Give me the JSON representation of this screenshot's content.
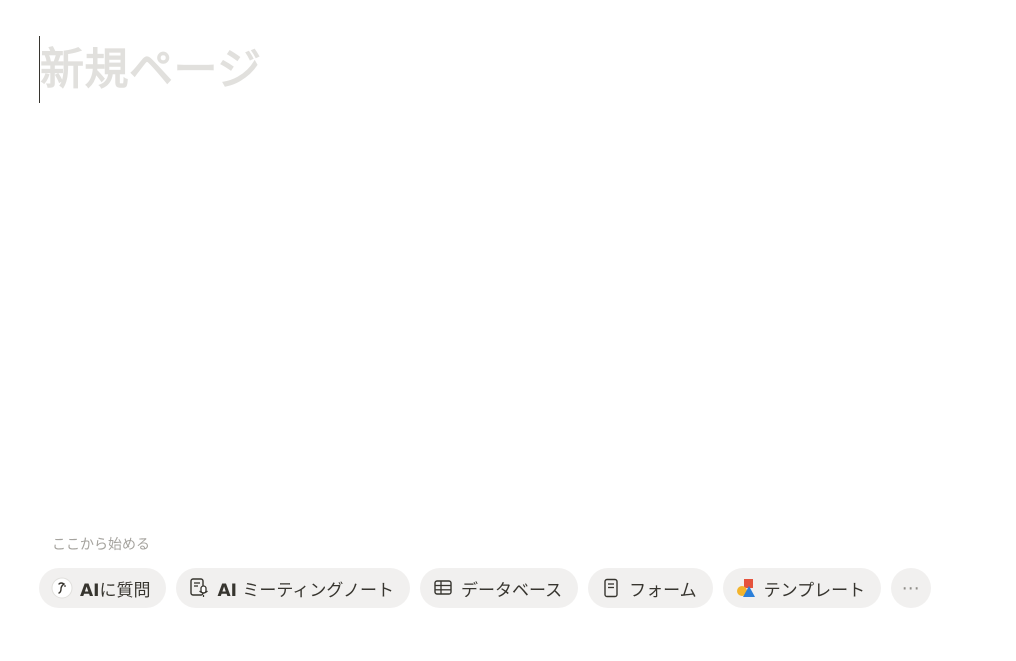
{
  "page": {
    "title_placeholder": "新規ページ"
  },
  "start": {
    "label": "ここから始める"
  },
  "actions": {
    "ask_ai": {
      "strong": "AI",
      "rest": "に質問",
      "icon": "ai-face-icon"
    },
    "meeting_notes": {
      "strong": "AI",
      "rest": " ミーティングノート",
      "icon": "meeting-notes-mic-icon"
    },
    "database": {
      "label": "データベース",
      "icon": "table-icon"
    },
    "form": {
      "label": "フォーム",
      "icon": "form-icon"
    },
    "template": {
      "label": "テンプレート",
      "icon": "template-shapes-icon"
    },
    "more": {
      "label": "⋯",
      "icon": "more-icon"
    }
  },
  "colors": {
    "pill_bg": "#f1f0ef",
    "placeholder": "#e1e0dd",
    "text": "#37352f",
    "muted": "#a5a39e",
    "template_red": "#e5533d",
    "template_yellow": "#f3b42c",
    "template_blue": "#2b7fd9"
  }
}
